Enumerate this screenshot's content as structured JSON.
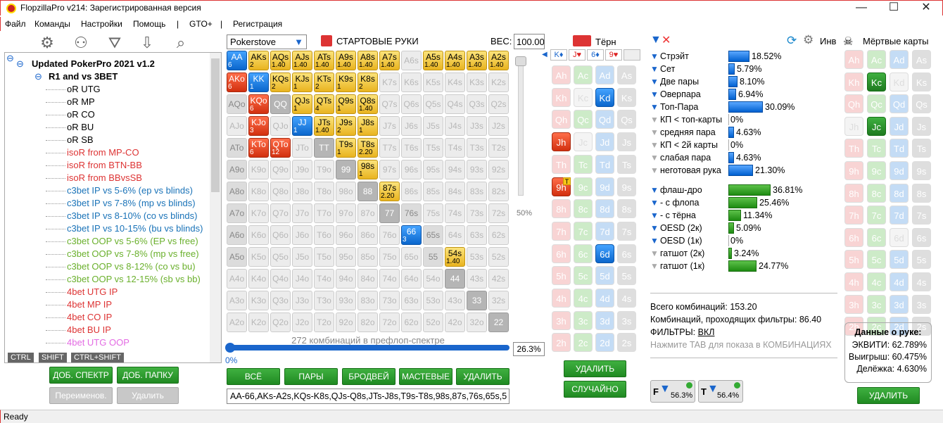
{
  "window": {
    "title": "FlopzillaPro v214: Зарегистрированная версия"
  },
  "menu": [
    "Файл",
    "Команды",
    "Настройки",
    "Помощь",
    "|",
    "GTO+",
    "|",
    "Регистрация"
  ],
  "tree": {
    "root": "Updated PokerPro 2021 v1.2",
    "folder": "R1 and vs 3BET",
    "items": [
      {
        "label": "oR UTG",
        "color": "#000"
      },
      {
        "label": "oR MP",
        "color": "#000"
      },
      {
        "label": "oR CO",
        "color": "#000"
      },
      {
        "label": "oR BU",
        "color": "#000"
      },
      {
        "label": "oR SB",
        "color": "#000"
      },
      {
        "label": "isoR from MP-CO",
        "color": "#d33"
      },
      {
        "label": "isoR from BTN-BB",
        "color": "#d33"
      },
      {
        "label": "isoR from BBvsSB",
        "color": "#d33"
      },
      {
        "label": "c3bet IP vs 5-6% (ep vs blinds)",
        "color": "#1a73b8"
      },
      {
        "label": "c3bet IP vs 7-8% (mp vs blinds)",
        "color": "#1a73b8"
      },
      {
        "label": "c3bet IP vs 8-10% (co vs blinds)",
        "color": "#1a73b8"
      },
      {
        "label": "c3bet IP vs 10-15% (bu vs blinds)",
        "color": "#1a73b8"
      },
      {
        "label": "c3bet OOP vs 5-6% (EP vs free)",
        "color": "#6ab02c"
      },
      {
        "label": "c3bet OOP vs 7-8% (mp vs free)",
        "color": "#6ab02c"
      },
      {
        "label": "c3bet OOP vs 8-12% (co vs bu)",
        "color": "#6ab02c"
      },
      {
        "label": "c3bet OOP vs 12-15% (sb vs bb)",
        "color": "#6ab02c"
      },
      {
        "label": "4bet UTG IP",
        "color": "#d33"
      },
      {
        "label": "4bet MP IP",
        "color": "#d33"
      },
      {
        "label": "4bet CO IP",
        "color": "#d33"
      },
      {
        "label": "4bet BU IP",
        "color": "#d33"
      },
      {
        "label": "4bet UTG OOP",
        "color": "#e36be3"
      }
    ],
    "tabs": [
      "CTRL",
      "SHIFT",
      "CTRL+SHIFT"
    ]
  },
  "left_buttons": {
    "add_spectrum": "ДОБ. СПЕКТР",
    "add_folder": "ДОБ. ПАПКУ",
    "rename": "Переименов.",
    "delete": "Удалить"
  },
  "range_panel": {
    "select": "Pokerstove",
    "title": "СТАРТОВЫЕ РУКИ",
    "weight_label": "ВЕС:",
    "weight_value": "100.00",
    "pct_under_slider": "50%",
    "combos_label": "272 комбинаций в префлоп-спектре",
    "progress_left": "0%",
    "progress_value": "26.3%",
    "buttons": [
      "ВСЁ",
      "ПАРЫ",
      "БРОДВЕЙ",
      "МАСТЕВЫЕ",
      "УДАЛИТЬ"
    ],
    "range_text": "AA-66,AKs-A2s,KQs-K8s,QJs-Q8s,JTs-J8s,T9s-T8s,98s,87s,76s,65s,5"
  },
  "grid_cells": [
    [
      "AA|6|b",
      "AKs|2|y",
      "AQs|1.40|y",
      "AJs|1.40|y",
      "ATs|1.40|y",
      "A9s|1.40|y",
      "A8s|1.40|y",
      "A7s|1.40|y",
      "A6s||n",
      "A5s|1.40|y",
      "A4s|1.40|y",
      "A3s|1.40|y",
      "A2s|1.40|y"
    ],
    [
      "AKo|6|r",
      "KK|1|b",
      "KQs|2|y",
      "KJs|1|y",
      "KTs|2|y",
      "K9s|1|y",
      "K8s|2|y",
      "K7s||n",
      "K6s||n",
      "K5s||n",
      "K4s||n",
      "K3s||n",
      "K2s||n"
    ],
    [
      "AQo||gl",
      "KQo|6|r",
      "QQ||g",
      "QJs|1|y",
      "QTs|4|y",
      "Q9s|1|y",
      "Q8s|1.40|y",
      "Q7s||n",
      "Q6s||n",
      "Q5s||n",
      "Q4s||n",
      "Q3s||n",
      "Q2s||n"
    ],
    [
      "AJo||n",
      "KJo|3|r",
      "QJo||n",
      "JJ|1|b",
      "JTs|1.40|y",
      "J9s|2|y",
      "J8s|1|y",
      "J7s||n",
      "J6s||n",
      "J5s||n",
      "J4s||n",
      "J3s||n",
      "J2s||n"
    ],
    [
      "ATo||gl",
      "KTo|6|r",
      "QTo|12|r",
      "JTo||n",
      "TT||g",
      "T9s|1|y",
      "T8s|2.20|y",
      "T7s||n",
      "T6s||n",
      "T5s||n",
      "T4s||n",
      "T3s||n",
      "T2s||n"
    ],
    [
      "A9o||gl",
      "K9o||n",
      "Q9o||n",
      "J9o||n",
      "T9o||n",
      "99||g",
      "98s|1|y",
      "97s||n",
      "96s||n",
      "95s||n",
      "94s||n",
      "93s||n",
      "92s||n"
    ],
    [
      "A8o||gl",
      "K8o||n",
      "Q8o||n",
      "J8o||n",
      "T8o||n",
      "98o||n",
      "88||g",
      "87s|2.20|y",
      "86s||n",
      "85s||n",
      "84s||n",
      "83s||n",
      "82s||n"
    ],
    [
      "A7o||gl",
      "K7o||n",
      "Q7o||n",
      "J7o||n",
      "T7o||n",
      "97o||n",
      "87o||n",
      "77||g",
      "76s||gl",
      "75s||n",
      "74s||n",
      "73s||n",
      "72s||n"
    ],
    [
      "A6o||gl",
      "K6o||n",
      "Q6o||n",
      "J6o||n",
      "T6o||n",
      "96o||n",
      "86o||n",
      "76o||n",
      "66|3|b",
      "65s||gl",
      "64s||n",
      "63s||n",
      "62s||n"
    ],
    [
      "A5o||gl",
      "K5o||n",
      "Q5o||n",
      "J5o||n",
      "T5o||n",
      "95o||n",
      "85o||n",
      "75o||n",
      "65o||n",
      "55||gl",
      "54s|1.40|y",
      "53s||n",
      "52s||n"
    ],
    [
      "A4o||n",
      "K4o||n",
      "Q4o||n",
      "J4o||n",
      "T4o||n",
      "94o||n",
      "84o||n",
      "74o||n",
      "64o||n",
      "54o||n",
      "44||g",
      "43s||n",
      "42s||n"
    ],
    [
      "A3o||n",
      "K3o||n",
      "Q3o||n",
      "J3o||n",
      "T3o||n",
      "93o||n",
      "83o||n",
      "73o||n",
      "63o||n",
      "53o||n",
      "43o||n",
      "33||g",
      "32s||n"
    ],
    [
      "A2o||n",
      "K2o||n",
      "Q2o||n",
      "J2o||n",
      "T2o||n",
      "92o||n",
      "82o||n",
      "72o||n",
      "62o||n",
      "52o||n",
      "42o||n",
      "32o||n",
      "22||g"
    ]
  ],
  "turn_panel": {
    "title": "Тёрн",
    "board": [
      "K♦",
      "J♥",
      "6♦",
      "9♥"
    ],
    "cards": [
      [
        "Ah|n",
        "Ac|n",
        "Ad|n",
        "As|n"
      ],
      [
        "Kh|n",
        "Kc|w",
        "Kd|b",
        "Ks|n"
      ],
      [
        "Qh|n",
        "Qc|n",
        "Qd|n",
        "Qs|n"
      ],
      [
        "Jh|r",
        "Jc|w",
        "Jd|n",
        "Js|n"
      ],
      [
        "Th|n",
        "Tc|n",
        "Td|n",
        "Ts|n"
      ],
      [
        "9h|r",
        "9c|n",
        "9d|n",
        "9s|n"
      ],
      [
        "8h|n",
        "8c|n",
        "8d|n",
        "8s|n"
      ],
      [
        "7h|n",
        "7c|n",
        "7d|n",
        "7s|n"
      ],
      [
        "6h|n",
        "6c|n",
        "6d|b",
        "6s|n"
      ],
      [
        "5h|n",
        "5c|n",
        "5d|n",
        "5s|n"
      ],
      [
        "4h|n",
        "4c|n",
        "4d|n",
        "4s|n"
      ],
      [
        "3h|n",
        "3c|n",
        "3d|n",
        "3s|n"
      ],
      [
        "2h|n",
        "2c|n",
        "2d|n",
        "2s|n"
      ]
    ],
    "delete": "УДАЛИТЬ",
    "random": "СЛУЧАЙНО"
  },
  "stats": {
    "made": [
      {
        "label": "Стрэйт",
        "pct": "18.52%",
        "v": 18.52,
        "active": true
      },
      {
        "label": "Сет",
        "pct": "5.79%",
        "v": 5.79,
        "active": true
      },
      {
        "label": "Две пары",
        "pct": "8.10%",
        "v": 8.1,
        "active": true
      },
      {
        "label": "Оверпара",
        "pct": "6.94%",
        "v": 6.94,
        "active": true
      },
      {
        "label": "Топ-Пара",
        "pct": "30.09%",
        "v": 30.09,
        "active": true
      },
      {
        "label": "КП < топ-карты",
        "pct": "0%",
        "v": 0,
        "active": false
      },
      {
        "label": "средняя пара",
        "pct": "4.63%",
        "v": 4.63,
        "active": false
      },
      {
        "label": "КП < 2й карты",
        "pct": "0%",
        "v": 0,
        "active": false
      },
      {
        "label": "слабая пара",
        "pct": "4.63%",
        "v": 4.63,
        "active": false
      },
      {
        "label": "неготовая рука",
        "pct": "21.30%",
        "v": 21.3,
        "active": false
      }
    ],
    "draws": [
      {
        "label": "флаш-дро",
        "pct": "36.81%",
        "v": 36.81,
        "active": true
      },
      {
        "label": "- с флопа",
        "pct": "25.46%",
        "v": 25.46,
        "active": true
      },
      {
        "label": "- с тёрна",
        "pct": "11.34%",
        "v": 11.34,
        "active": true
      },
      {
        "label": "OESD (2к)",
        "pct": "5.09%",
        "v": 5.09,
        "active": true
      },
      {
        "label": "OESD (1к)",
        "pct": "0%",
        "v": 0,
        "active": true
      },
      {
        "label": "гатшот (2к)",
        "pct": "3.24%",
        "v": 3.24,
        "active": false
      },
      {
        "label": "гатшот (1к)",
        "pct": "24.77%",
        "v": 24.77,
        "active": false
      }
    ],
    "total": "Всего комбинаций: 153.20",
    "passing": "Комбинаций, проходящих фильтры: 86.40",
    "filters_label": "ФИЛЬТРЫ:",
    "filters_value": "ВКЛ",
    "hint": "Нажмите TAB для показа в КОМБИНАЦИЯХ",
    "f_pct": "56.3%",
    "t_pct": "56.4%",
    "inv_label": "Инв"
  },
  "dead": {
    "title": "Мёртвые карты",
    "cards": [
      [
        "Ah",
        "Ac",
        "Ad",
        "As"
      ],
      [
        "Kh",
        "Kc|g",
        "Kd|w",
        "Ks"
      ],
      [
        "Qh",
        "Qc",
        "Qd",
        "Qs"
      ],
      [
        "Jh|w",
        "Jc|g",
        "Jd",
        "Js"
      ],
      [
        "Th",
        "Tc",
        "Td",
        "Ts"
      ],
      [
        "9h",
        "9c",
        "9d",
        "9s"
      ],
      [
        "8h",
        "8c",
        "8d",
        "8s"
      ],
      [
        "7h",
        "7c",
        "7d",
        "7s"
      ],
      [
        "6h",
        "6c",
        "6d|w",
        "6s"
      ],
      [
        "5h",
        "5c",
        "5d",
        "5s"
      ],
      [
        "4h",
        "4c",
        "4d",
        "4s"
      ],
      [
        "3h",
        "3c",
        "3d",
        "3s"
      ],
      [
        "2h",
        "2c",
        "2d",
        "2s"
      ]
    ],
    "hand_title": "Данные о руке:",
    "equity": "ЭКВИТИ: 62.789%",
    "wins": "Выигрыш: 60.475%",
    "split": "Делёжка: 4.630%",
    "delete": "УДАЛИТЬ"
  },
  "status": "Ready"
}
